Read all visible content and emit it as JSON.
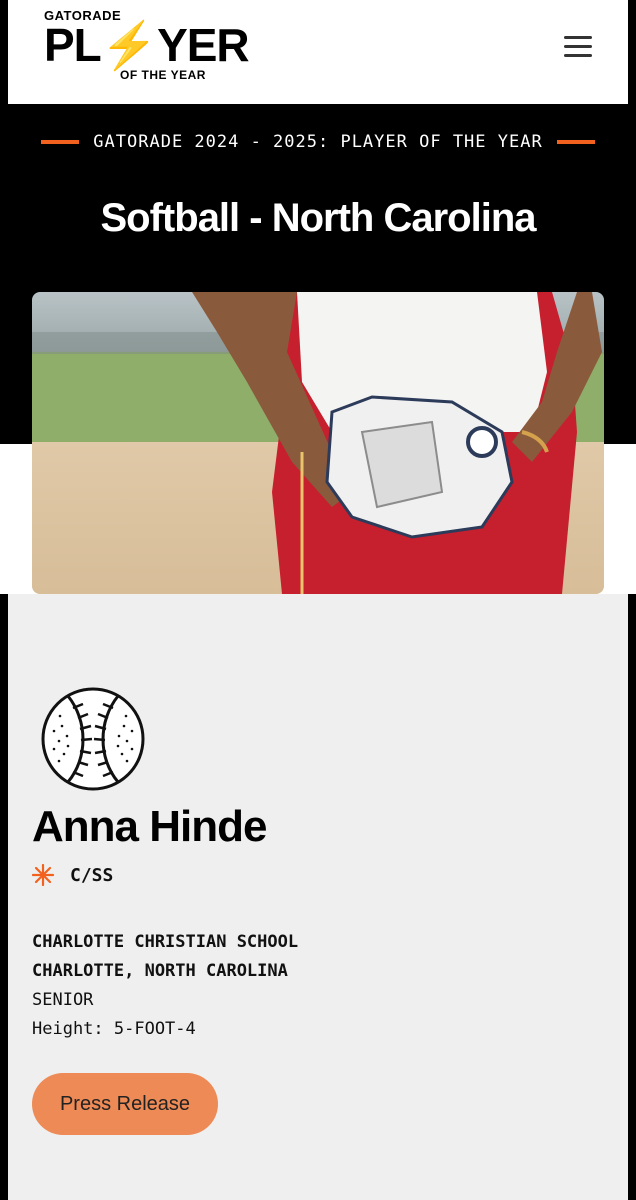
{
  "header": {
    "logo_top": "GATORADE",
    "logo_main_a": "PL",
    "logo_main_b": "YER",
    "logo_sub": "OF THE YEAR"
  },
  "hero": {
    "eyebrow": "GATORADE 2024 - 2025: PLAYER OF THE YEAR",
    "title": "Softball - North Carolina"
  },
  "player": {
    "name": "Anna Hinde",
    "position": "C/SS",
    "school": "CHARLOTTE CHRISTIAN SCHOOL",
    "location": "CHARLOTTE, NORTH CAROLINA",
    "year": "SENIOR",
    "height": "Height: 5-FOOT-4"
  },
  "actions": {
    "press_release_label": "Press Release"
  },
  "colors": {
    "accent": "#f2621e",
    "button": "#ee8a55",
    "card_bg": "#efefef"
  }
}
